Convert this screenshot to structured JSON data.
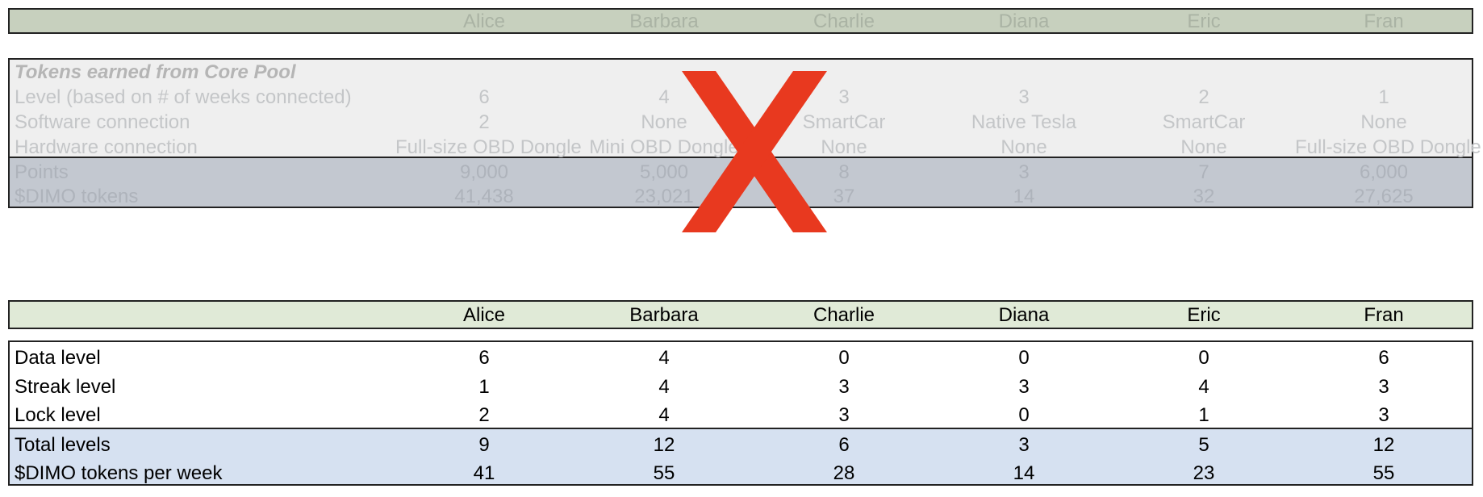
{
  "columns": [
    "Alice",
    "Barbara",
    "Charlie",
    "Diana",
    "Eric",
    "Fran"
  ],
  "old_table": {
    "title": "Tokens earned from Core Pool",
    "rows": [
      {
        "label": "Level (based on # of weeks connected)",
        "values": [
          "6",
          "4",
          "3",
          "3",
          "2",
          "1"
        ]
      },
      {
        "label": "Software connection",
        "values": [
          "2",
          "None",
          "SmartCar",
          "Native Tesla",
          "SmartCar",
          "None"
        ]
      },
      {
        "label": "Hardware connection",
        "values": [
          "Full-size OBD Dongle",
          "Mini OBD Dongle",
          "None",
          "None",
          "None",
          "Full-size OBD Dongle"
        ]
      },
      {
        "label": "Points",
        "values": [
          "9,000",
          "5,000",
          "8",
          "3",
          "7",
          "6,000"
        ]
      },
      {
        "label": "$DIMO tokens",
        "values": [
          "41,438",
          "23,021",
          "37",
          "14",
          "32",
          "27,625"
        ]
      }
    ]
  },
  "new_table": {
    "rows": [
      {
        "label": "Data level",
        "values": [
          "6",
          "4",
          "0",
          "0",
          "0",
          "6"
        ]
      },
      {
        "label": "Streak level",
        "values": [
          "1",
          "4",
          "3",
          "3",
          "4",
          "3"
        ]
      },
      {
        "label": "Lock level",
        "values": [
          "2",
          "4",
          "3",
          "0",
          "1",
          "3"
        ]
      },
      {
        "label": "Total levels",
        "values": [
          "9",
          "12",
          "6",
          "3",
          "5",
          "12"
        ]
      },
      {
        "label": "$DIMO tokens per week",
        "values": [
          "41",
          "55",
          "28",
          "14",
          "23",
          "55"
        ]
      }
    ]
  },
  "colors": {
    "header_green_faded": "#c7d0be",
    "gray_band": "#efefef",
    "dark_gray_band": "#c3c8d0",
    "header_green": "#e0ead7",
    "blue_band": "#d6e1f1",
    "x_red": "#e8391f"
  },
  "icons": {
    "crossed_out": "x-mark-icon"
  }
}
